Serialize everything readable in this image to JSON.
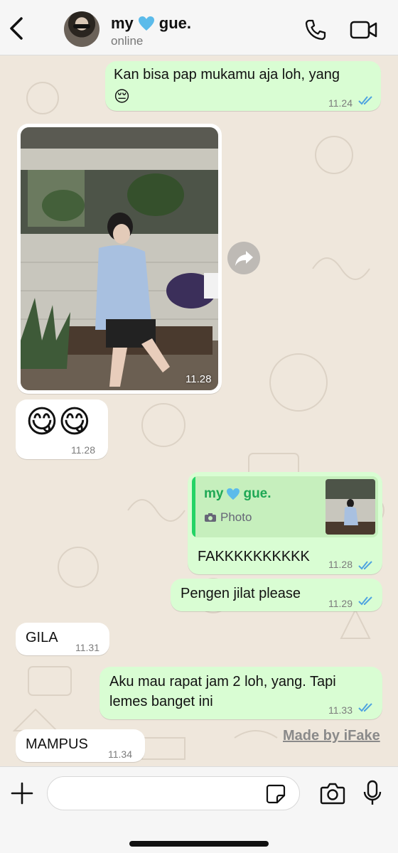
{
  "header": {
    "contact_name": "my",
    "contact_name_suffix": "gue.",
    "heart_icon": "blue-heart",
    "status": "online"
  },
  "messages": [
    {
      "id": "m1",
      "side": "out",
      "text": "Kan bisa pap mukamu aja loh, yang",
      "emoji": "😔",
      "time": "11.24",
      "read": true
    },
    {
      "id": "m2",
      "side": "in",
      "type": "photo",
      "time": "11.28"
    },
    {
      "id": "m3",
      "side": "in",
      "emoji": "😋😋",
      "time": "11.28"
    },
    {
      "id": "m4",
      "side": "out",
      "reply_to_name": "my",
      "reply_to_name_suffix": "gue.",
      "reply_to_type": "Photo",
      "text": "FAKKKKKKKKKK",
      "time": "11.28",
      "read": true
    },
    {
      "id": "m5",
      "side": "out",
      "text": "Pengen jilat please",
      "time": "11.29",
      "read": true
    },
    {
      "id": "m6",
      "side": "in",
      "text": "GILA",
      "time": "11.31"
    },
    {
      "id": "m7",
      "side": "out",
      "text_line1": "Aku mau rapat jam 2 loh, yang. Tapi",
      "text_line2": "lemes banget ini",
      "time": "11.33",
      "read": true
    },
    {
      "id": "m8",
      "side": "in",
      "text": "MAMPUS",
      "time": "11.34"
    }
  ],
  "watermark": "Made by iFake",
  "input": {
    "placeholder": "",
    "value": ""
  },
  "colors": {
    "outgoing_bubble": "#d9fdd3",
    "incoming_bubble": "#ffffff",
    "read_ticks": "#4fa3e0",
    "reply_accent": "#25d366",
    "heart": "#5bbbea"
  },
  "icons": [
    "back-icon",
    "phone-icon",
    "video-camera-icon",
    "forward-icon",
    "camera-icon",
    "plus-icon",
    "sticker-icon",
    "microphone-icon"
  ]
}
